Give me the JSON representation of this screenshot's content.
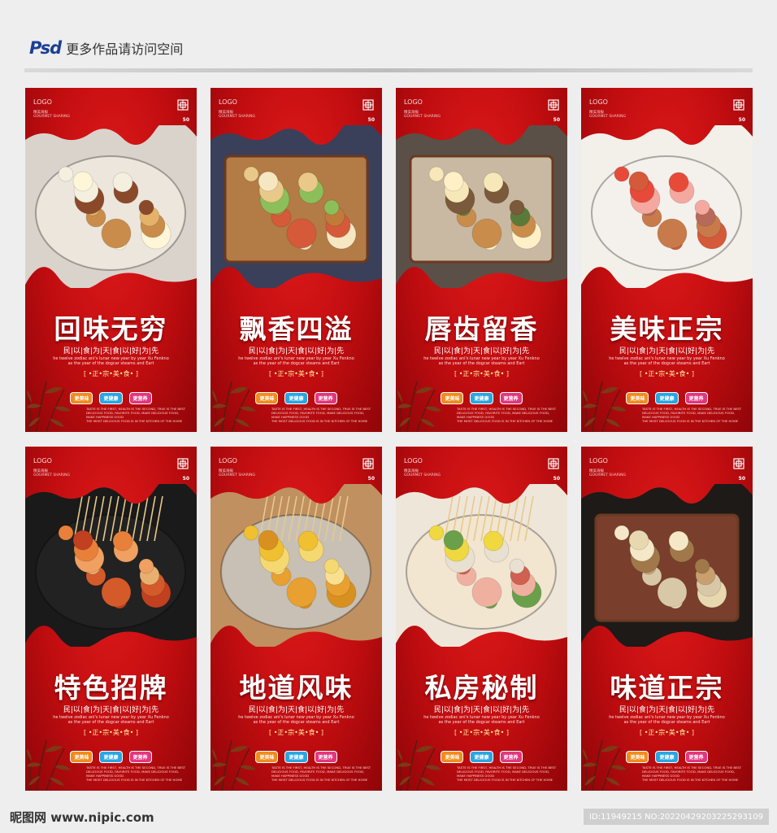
{
  "header": {
    "badge": "Psd",
    "text": "更多作品请访问空间"
  },
  "posters": [
    {
      "title": "回味无穷",
      "photo": "oden-pot-with-eggs-and-radish"
    },
    {
      "title": "飘香四溢",
      "photo": "partitioned-copper-oden-box"
    },
    {
      "title": "唇齿留香",
      "photo": "oden-box-with-tongs"
    },
    {
      "title": "美味正宗",
      "photo": "oden-bowl-with-sauce"
    },
    {
      "title": "特色招牌",
      "photo": "skewers-in-black-bowl"
    },
    {
      "title": "地道风味",
      "photo": "many-skewers-in-trays"
    },
    {
      "title": "私房秘制",
      "photo": "clay-pot-with-corn-and-balls"
    },
    {
      "title": "味道正宗",
      "photo": "copper-oden-pot-steaming"
    }
  ],
  "poster_common": {
    "logo": "LOGO",
    "logo_sub": "精美海报\nGOURMET SHARING",
    "mark_50": "50",
    "subtitle": "民|以|食|为|天|食|以|好|为|先",
    "english": "he twelve zodiac ani's lunar new year by year Xu Fenkno\nas the year of the dogcar steams and Eart",
    "tagline": "[ •正•宗•美•食• ]",
    "badge_1": "更美味",
    "badge_2": "更健康",
    "badge_3": "更营养",
    "small_print": "TASTE IS THE FIRST, HEALTH IS THE SECOND, TRUE IS THE BEST\nDELICIOUS FOOD, FAVORITE FOOD, MAKE DELICIOUS FOOD, MAKE HAPPINESS GOOD\nTHE MOST DELICIOUS FOOD IS IN THE KITCHEN OF THE HOME"
  },
  "colors": {
    "poster_red": "#c10d10",
    "badge_orange": "#f08c1e",
    "badge_blue": "#2aa6e0",
    "badge_pink": "#e2367d",
    "header_blue": "#1c3f94"
  },
  "footer": {
    "site": "昵图网 www.nipic.com",
    "id_text": "ID:11949215 NO:20220429203225293109"
  }
}
